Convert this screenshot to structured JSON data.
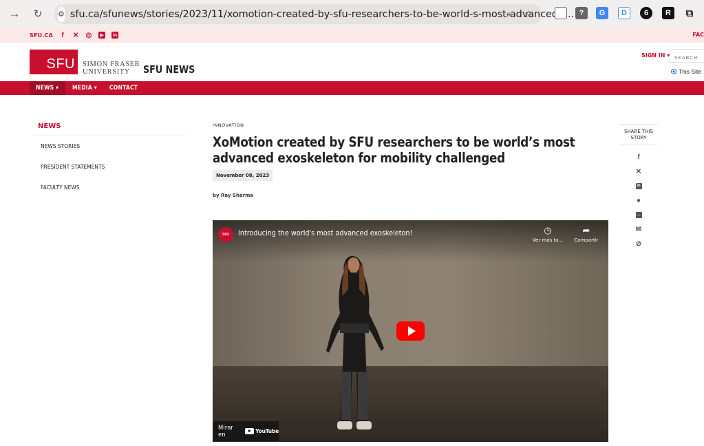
{
  "browser": {
    "url_host": "sfu.ca",
    "url_path": "/sfunews/stories/2023/11/xomotion-created-by-sfu-researchers-to-be-world-s-most-advanced-....",
    "back_icon": "arrow-forward",
    "reload_icon": "reload"
  },
  "utility": {
    "brand": "SFU.CA",
    "socials": [
      "facebook",
      "x",
      "instagram",
      "youtube",
      "linkedin"
    ],
    "right_text": "FAC"
  },
  "header": {
    "logo_text": "SFU",
    "university_line1": "SIMON FRASER",
    "university_line2": "UNIVERSITY",
    "site_title": "SFU NEWS",
    "signin": "SIGN IN ▾",
    "search_placeholder": "SEARCH",
    "scope": "This Site"
  },
  "nav": {
    "items": [
      "NEWS ▾",
      "MEDIA ▾",
      "CONTACT"
    ]
  },
  "sidebar": {
    "heading": "NEWS",
    "items": [
      "NEWS STORIES",
      "PRESIDENT STATEMENTS",
      "FACULTY NEWS"
    ]
  },
  "article": {
    "kicker": "INNOVATION",
    "headline": "XoMotion created by SFU researchers to be world’s most advanced exoskeleton for mobility challenged",
    "date": "November 08, 2023",
    "byline": "by Ray Sharma"
  },
  "video": {
    "channel": "SFU",
    "title": "Introducing the world's most advanced exoskeleton!",
    "watch_later": "Ver más ta...",
    "share": "Compartir",
    "watch_on": "Mirar en",
    "youtube": "YouTube"
  },
  "share": {
    "heading_line1": "SHARE THIS",
    "heading_line2": "STORY",
    "icons": [
      "facebook-icon",
      "x-icon",
      "linkedin-icon",
      "reddit-icon",
      "sms-icon",
      "email-icon",
      "link-icon"
    ]
  },
  "colors": {
    "sfu_red": "#c8102e",
    "nav_active": "#a40d26",
    "utility_bg": "#fbe9e7"
  }
}
